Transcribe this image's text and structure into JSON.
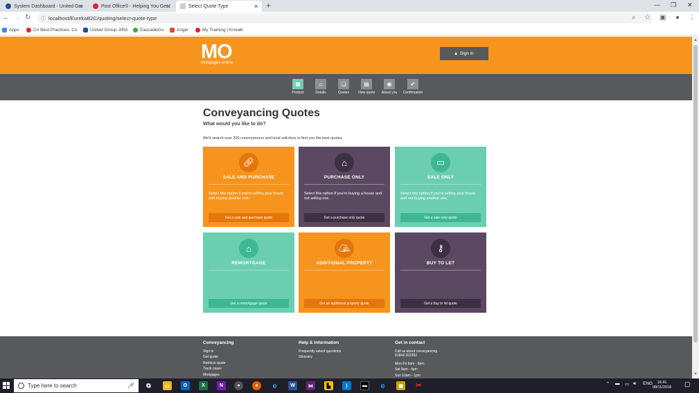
{
  "browser": {
    "tabs": [
      {
        "label": "System Dashboard - United Gro",
        "color": "#1f4e9c",
        "active": false
      },
      {
        "label": "Post Office® - Helping You Get I",
        "color": "#d9232e",
        "active": false
      },
      {
        "label": "Select Quote Type",
        "color": "#777777",
        "active": true
      }
    ],
    "url": "localhost/EurekaB2C/quoting/select-quote-type",
    "bookmarks": [
      {
        "label": "Apps",
        "color": "#4285f4"
      },
      {
        "label": "C# Best Practices: Co",
        "color": "#d9232e"
      },
      {
        "label": "United Group JIRA",
        "color": "#1f4e9c"
      },
      {
        "label": "CascadeGo",
        "color": "#3aa648"
      },
      {
        "label": "Angie",
        "color": "#e8472f"
      },
      {
        "label": "My Training | Knowb",
        "color": "#d9232e"
      }
    ]
  },
  "site": {
    "logo_main": "MO",
    "logo_sub": "mortgages online",
    "signin_label": "Sign in",
    "brand_color": "#f7941d",
    "steps": [
      {
        "label": "Product",
        "icon": "grid-icon",
        "active": true
      },
      {
        "label": "Details",
        "icon": "house-icon",
        "active": false
      },
      {
        "label": "Quotes",
        "icon": "quotes-icon",
        "active": false
      },
      {
        "label": "View quote",
        "icon": "document-icon",
        "active": false
      },
      {
        "label": "About you",
        "icon": "person-icon",
        "active": false
      },
      {
        "label": "Confirmation",
        "icon": "check-icon",
        "active": false
      }
    ],
    "title": "Conveyancing Quotes",
    "subtitle": "What would you like to do?",
    "intro": "We'll search over 200 conveyancers and local solicitors to find you the best quotes.",
    "cards": [
      {
        "title": "SALE AND PURCHASE",
        "desc": "Select this option if you're selling your house and buying another one.",
        "button": "Get a sale and purchase quote",
        "theme": "orange",
        "icon": "link-icon"
      },
      {
        "title": "PURCHASE ONLY",
        "desc": "Select this option if you're buying a house and not selling one.",
        "button": "Get a purchase only quote",
        "theme": "purple",
        "icon": "house-key-icon"
      },
      {
        "title": "SALE ONLY",
        "desc": "Select this option if you're selling your house and not buying another one.",
        "button": "Get a sale only quote",
        "theme": "teal",
        "icon": "sign-icon"
      },
      {
        "title": "REMORTGAGE",
        "desc": "",
        "button": "Get a remortgage quote",
        "theme": "teal",
        "icon": "house-icon"
      },
      {
        "title": "ADDITIONAL PROPERTY",
        "desc": "",
        "button": "Get an additional property quote",
        "theme": "orange",
        "icon": "house-plus-icon"
      },
      {
        "title": "BUY TO LET",
        "desc": "",
        "button": "Get a buy to let quote",
        "theme": "purple",
        "icon": "key-icon"
      }
    ],
    "footer": {
      "col1": {
        "heading": "Conveyancing",
        "links": [
          "Sign in",
          "Get quote",
          "Retrieve quote",
          "Track cases",
          "Mortgages"
        ]
      },
      "col2": {
        "heading": "Help & Information",
        "links": [
          "Frequently asked questions",
          "Glossary"
        ]
      },
      "col3": {
        "heading": "Get in contact",
        "lines": [
          "Call us about conveyancing",
          "01844 262392",
          "",
          "Mon-Fri 8am - 8pm",
          "Sat 9am - 4pm",
          "Sun 10am - 1pm"
        ]
      }
    }
  },
  "taskbar": {
    "search_placeholder": "Type here to search",
    "lang": "ENG",
    "time": "16:41",
    "date": "08/11/2018"
  }
}
